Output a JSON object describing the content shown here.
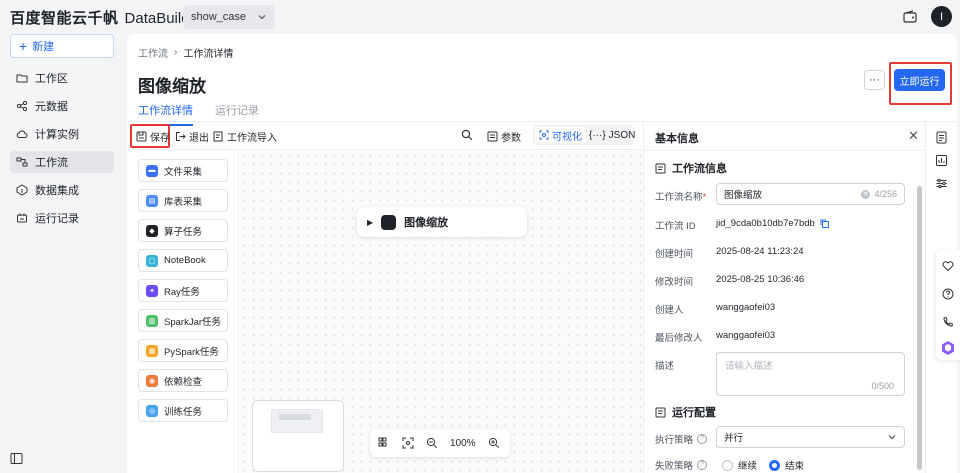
{
  "header": {
    "logo_cn": "百度智能云千帆",
    "logo_en": "DataBuilder",
    "workspace": "show_case",
    "avatar_letter": "I"
  },
  "sidebar": {
    "new_label": "新建",
    "items": [
      {
        "label": "工作区",
        "icon": "folder-icon"
      },
      {
        "label": "元数据",
        "icon": "share-nodes-icon"
      },
      {
        "label": "计算实例",
        "icon": "cloud-icon"
      },
      {
        "label": "工作流",
        "icon": "workflow-icon",
        "active": true
      },
      {
        "label": "数据集成",
        "icon": "integration-icon"
      },
      {
        "label": "运行记录",
        "icon": "record-icon"
      }
    ]
  },
  "breadcrumb": {
    "parent": "工作流",
    "current": "工作流详情"
  },
  "page": {
    "title": "图像缩放",
    "more": "···",
    "run_button": "立即运行",
    "tabs": [
      "工作流详情",
      "运行记录"
    ]
  },
  "toolbar": {
    "save": "保存",
    "exit": "退出",
    "import": "工作流导入",
    "params": "参数",
    "visual": "可视化",
    "json": "JSON"
  },
  "palette": [
    {
      "label": "文件采集",
      "color": "#3b6ff5"
    },
    {
      "label": "库表采集",
      "color": "#4b8cf7"
    },
    {
      "label": "算子任务",
      "color": "#1f2329"
    },
    {
      "label": "NoteBook",
      "color": "#35b6d6"
    },
    {
      "label": "Ray任务",
      "color": "#6b4cf6"
    },
    {
      "label": "SparkJar任务",
      "color": "#4fbf6a"
    },
    {
      "label": "PySpark任务",
      "color": "#f5a623"
    },
    {
      "label": "依赖检查",
      "color": "#f07a3a"
    },
    {
      "label": "训练任务",
      "color": "#4aa3f0"
    }
  ],
  "canvas": {
    "node_label": "图像缩放",
    "zoom": "100%"
  },
  "panel": {
    "title": "基本信息",
    "section_info": "工作流信息",
    "fields": {
      "name_label": "工作流名称",
      "name_value": "图像缩放",
      "name_count": "4/256",
      "id_label": "工作流 ID",
      "id_value": "jid_9cda0b10db7e7bdb",
      "created_label": "创建时间",
      "created_value": "2025-08-24 11:23:24",
      "modified_label": "修改时间",
      "modified_value": "2025-08-25 10:36:46",
      "creator_label": "创建人",
      "creator_value": "wanggaofei03",
      "last_modifier_label": "最后修改人",
      "last_modifier_value": "wanggaofei03",
      "desc_label": "描述",
      "desc_placeholder": "请输入描述",
      "desc_count": "0/500"
    },
    "section_run": "运行配置",
    "strategy_label": "执行策略",
    "strategy_value": "并行",
    "fail_label": "失败策略",
    "fail_options": [
      "继续",
      "结束"
    ],
    "fail_selected": "结束"
  }
}
